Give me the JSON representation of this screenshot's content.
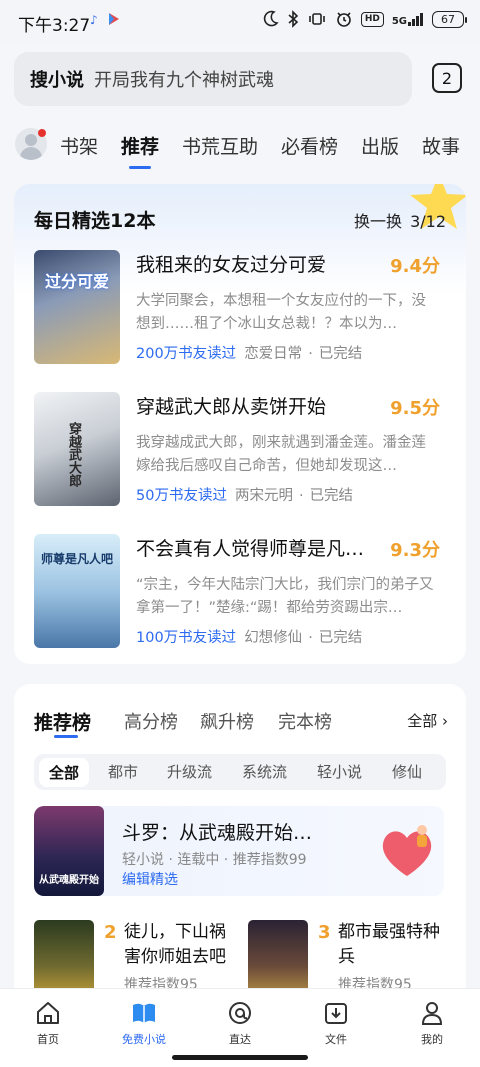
{
  "status_bar": {
    "time": "下午3:27",
    "hd_label": "HD",
    "network_label": "5G",
    "battery": "67"
  },
  "search": {
    "brand": "搜小说",
    "query": "开局我有九个神树武魂",
    "tab_count": "2"
  },
  "nav_tabs": [
    "书架",
    "推荐",
    "书荒互助",
    "必看榜",
    "出版",
    "故事"
  ],
  "daily": {
    "title": "每日精选12本",
    "refresh_label": "换一换",
    "page_indicator": "3/12",
    "books": [
      {
        "title": "我租来的女友过分可爱",
        "score": "9.4分",
        "desc": "大学同聚会，本想租一个女友应付的一下，没想到……租了个冰山女总裁！？本以为…",
        "readers": "200万书友读过",
        "genre": "恋爱日常",
        "status": "已完结",
        "cover_text": "过分可爱",
        "cover_colors": [
          "#3a4b6e",
          "#d8b874"
        ]
      },
      {
        "title": "穿越武大郎从卖饼开始",
        "score": "9.5分",
        "desc": "我穿越成武大郎，刚来就遇到潘金莲。潘金莲嫁给我后感叹自己命苦，但她却发现这…",
        "readers": "50万书友读过",
        "genre": "两宋元明",
        "status": "已完结",
        "cover_text": "穿越武大郎",
        "cover_colors": [
          "#e9ecef",
          "#5c6470"
        ]
      },
      {
        "title": "不会真有人觉得师尊是凡…",
        "score": "9.3分",
        "desc": "“宗主，今年大陆宗门大比，我们宗门的弟子又拿第一了！”楚缘:“踢！都给劳资踢出宗…",
        "readers": "100万书友读过",
        "genre": "幻想修仙",
        "status": "已完结",
        "cover_text": "师尊是凡人吧",
        "cover_colors": [
          "#cfe6f5",
          "#4a77a8"
        ]
      }
    ]
  },
  "ranking": {
    "tabs": [
      "推荐榜",
      "高分榜",
      "飙升榜",
      "完本榜"
    ],
    "all_label": "全部",
    "chips": [
      "全部",
      "都市",
      "升级流",
      "系统流",
      "轻小说",
      "修仙"
    ],
    "featured": {
      "title": "斗罗：从武魂殿开始…",
      "meta": "轻小说 · 连载中 · 推荐指数99",
      "edit_label": "编辑精选",
      "cover_text": "从武魂殿开始"
    },
    "items": [
      {
        "rank": "2",
        "title": "徒儿，下山祸害你师姐去吧",
        "score": "推荐指数95",
        "cover_colors": [
          "#2b3a20",
          "#d3a93a"
        ]
      },
      {
        "rank": "3",
        "title": "都市最强特种兵",
        "score": "推荐指数95",
        "cover_colors": [
          "#2a2233",
          "#c7a246"
        ]
      }
    ]
  },
  "bottom_nav": [
    {
      "label": "首页",
      "icon": "home-icon"
    },
    {
      "label": "免费小说",
      "icon": "book-icon"
    },
    {
      "label": "直达",
      "icon": "direct-icon"
    },
    {
      "label": "文件",
      "icon": "file-icon"
    },
    {
      "label": "我的",
      "icon": "profile-icon"
    }
  ],
  "colors": {
    "accent": "#2d6bf0",
    "score": "#f0a02c",
    "badge_dot": "#e5322d"
  }
}
